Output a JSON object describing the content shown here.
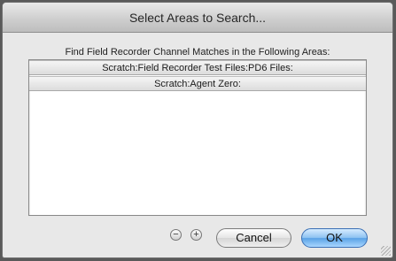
{
  "dialog": {
    "title": "Select Areas to Search..."
  },
  "prompt": "Find Field Recorder Channel Matches in the Following Areas:",
  "areas": [
    "Scratch:Field Recorder Test Files:PD6 Files:",
    "Scratch:Agent Zero:"
  ],
  "buttons": {
    "remove_symbol": "−",
    "add_symbol": "+",
    "cancel_label": "Cancel",
    "ok_label": "OK"
  },
  "colors": {
    "default_button": "#5aa2e6"
  }
}
